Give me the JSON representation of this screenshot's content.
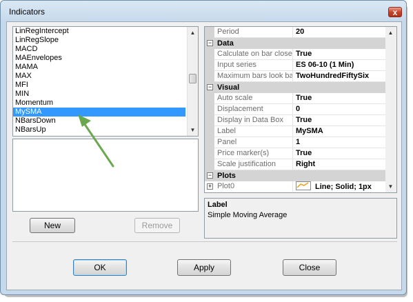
{
  "window": {
    "title": "Indicators",
    "close_glyph": "x"
  },
  "indicator_list": {
    "items": [
      "LinRegIntercept",
      "LinRegSlope",
      "MACD",
      "MAEnvelopes",
      "MAMA",
      "MAX",
      "MFI",
      "MIN",
      "Momentum",
      "MySMA",
      "NBarsDown",
      "NBarsUp"
    ],
    "selected": "MySMA"
  },
  "buttons": {
    "new": "New",
    "remove": "Remove",
    "ok": "OK",
    "apply": "Apply",
    "close": "Close"
  },
  "properties": {
    "top_row": {
      "name": "Period",
      "value": "20"
    },
    "data_category": "Data",
    "data_rows": [
      {
        "name": "Calculate on bar close",
        "value": "True"
      },
      {
        "name": "Input series",
        "value": "ES 06-10 (1 Min)"
      },
      {
        "name": "Maximum bars look ba",
        "value": "TwoHundredFiftySix"
      }
    ],
    "visual_category": "Visual",
    "visual_rows": [
      {
        "name": "Auto scale",
        "value": "True"
      },
      {
        "name": "Displacement",
        "value": "0"
      },
      {
        "name": "Display in Data Box",
        "value": "True"
      },
      {
        "name": "Label",
        "value": "MySMA"
      },
      {
        "name": "Panel",
        "value": "1"
      },
      {
        "name": "Price marker(s)",
        "value": "True"
      },
      {
        "name": "Scale justification",
        "value": "Right"
      }
    ],
    "plots_category": "Plots",
    "plots_row": {
      "name": "Plot0",
      "value": "Line; Solid; 1px"
    },
    "category_expand_glyph": "−",
    "row_expand_glyph": "+"
  },
  "help": {
    "title": "Label",
    "text": "Simple Moving Average"
  },
  "icons": {
    "scroll_up": "▲",
    "scroll_down": "▼"
  },
  "colors": {
    "selection": "#3399ff",
    "arrow": "#6aa84f",
    "plot_line": "#e8a317"
  }
}
